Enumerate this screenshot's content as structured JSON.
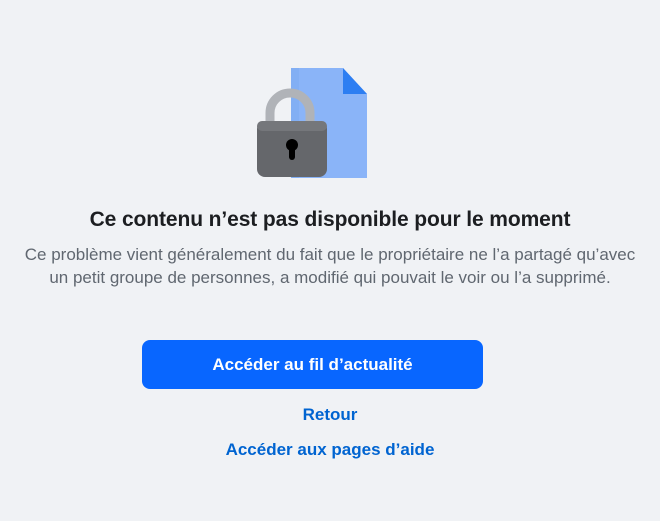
{
  "error": {
    "title": "Ce contenu n’est pas disponible pour le moment",
    "description": "Ce problème vient généralement du fait que le propriétaire ne l’a partagé qu’avec un petit groupe de personnes, a modifié qui pouvait le voir ou l’a supprimé.",
    "illustration_icons": [
      "padlock-icon",
      "document-icon"
    ]
  },
  "actions": {
    "primary_label": "Accéder au fil d’actualité",
    "back_label": "Retour",
    "help_label": "Accéder aux pages d’aide"
  },
  "colors": {
    "background": "#f0f2f5",
    "primary_button": "#0866ff",
    "link": "#0064d1",
    "title": "#1c1e21",
    "description": "#606770"
  }
}
